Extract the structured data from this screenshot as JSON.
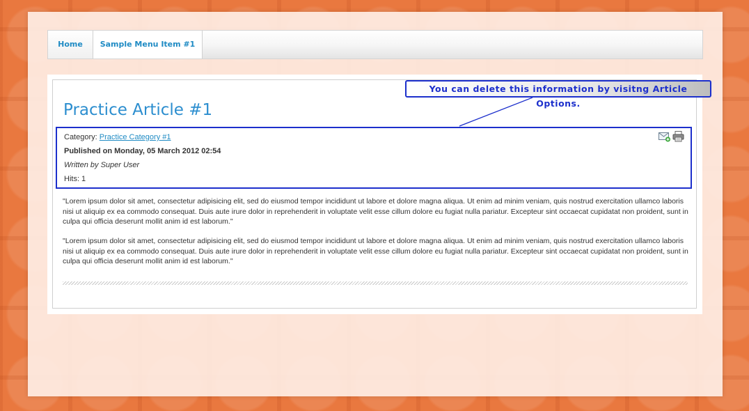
{
  "nav": {
    "items": [
      {
        "label": "Home"
      },
      {
        "label": "Sample Menu Item #1"
      }
    ]
  },
  "article": {
    "title": "Practice Article #1",
    "category_prefix": "Category:",
    "category_link": "Practice Category #1",
    "published": "Published on Monday, 05 March 2012 02:54",
    "author": "Written by Super User",
    "hits": "Hits: 1",
    "paragraphs": [
      "\"Lorem ipsum dolor sit amet, consectetur adipisicing elit, sed do eiusmod tempor incididunt ut labore et dolore magna aliqua. Ut enim ad minim veniam, quis nostrud exercitation ullamco laboris nisi ut aliquip ex ea commodo consequat. Duis aute irure dolor in reprehenderit in voluptate velit esse cillum dolore eu fugiat nulla pariatur. Excepteur sint occaecat cupidatat non proident, sunt in culpa qui officia deserunt mollit anim id est laborum.\"",
      "\"Lorem ipsum dolor sit amet, consectetur adipisicing elit, sed do eiusmod tempor incididunt ut labore et dolore magna aliqua. Ut enim ad minim veniam, quis nostrud exercitation ullamco laboris nisi ut aliquip ex ea commodo consequat. Duis aute irure dolor in reprehenderit in voluptate velit esse cillum dolore eu fugiat nulla pariatur. Excepteur sint occaecat cupidatat non proident, sunt in culpa qui officia deserunt mollit anim id est laborum.\""
    ]
  },
  "annotation": {
    "text": "You can delete this information by visitng Article Options."
  },
  "icons": {
    "email": "email-icon",
    "print": "print-icon"
  },
  "colors": {
    "background": "#e9783f",
    "link": "#1f8bc4",
    "title": "#2c8ecf",
    "annotation": "#1c2fcc"
  }
}
